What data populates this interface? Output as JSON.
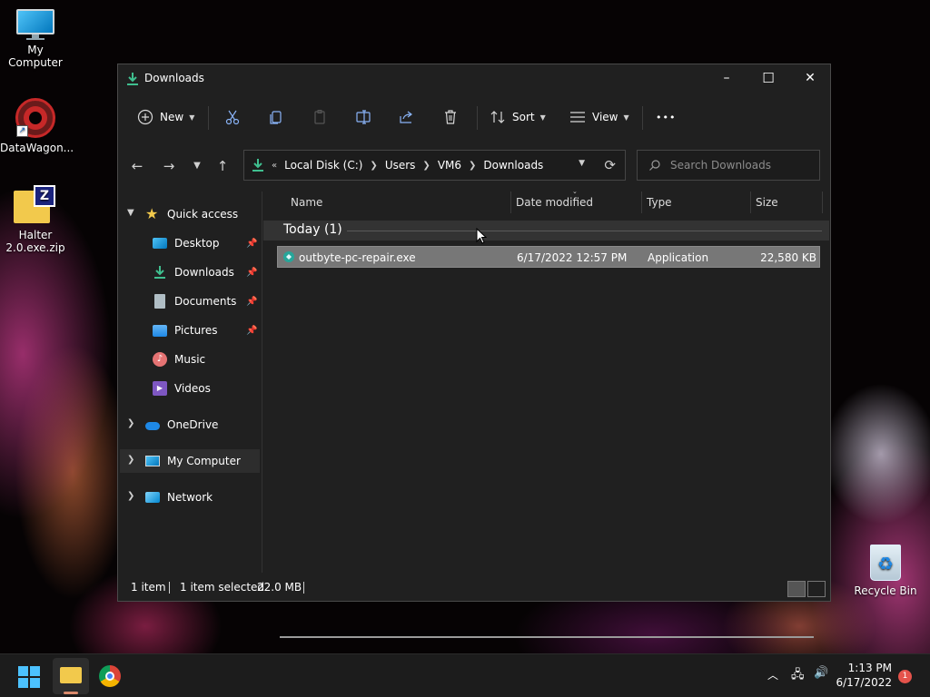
{
  "desktop": {
    "icons": [
      {
        "label": "My Computer"
      },
      {
        "label": "DataWagon..."
      },
      {
        "label": "Halter 2.0.exe.zip"
      },
      {
        "label": "Recycle Bin"
      }
    ]
  },
  "window": {
    "title": "Downloads",
    "controls": {
      "minimize": "–",
      "maximize": "☐",
      "close": "✕"
    }
  },
  "toolbar": {
    "new_label": "New",
    "sort_label": "Sort",
    "view_label": "View",
    "more_label": "•••"
  },
  "address": {
    "overflow": "«",
    "crumbs": [
      "Local Disk (C:)",
      "Users",
      "VM6",
      "Downloads"
    ]
  },
  "search": {
    "placeholder": "Search Downloads"
  },
  "sidebar": {
    "quick_access": "Quick access",
    "items": [
      {
        "label": "Desktop",
        "pinned": true
      },
      {
        "label": "Downloads",
        "pinned": true
      },
      {
        "label": "Documents",
        "pinned": true
      },
      {
        "label": "Pictures",
        "pinned": true
      },
      {
        "label": "Music",
        "pinned": false
      },
      {
        "label": "Videos",
        "pinned": false
      }
    ],
    "onedrive": "OneDrive",
    "my_computer": "My Computer",
    "network": "Network"
  },
  "columns": {
    "name": "Name",
    "date_modified": "Date modified",
    "type": "Type",
    "size": "Size"
  },
  "group": {
    "label": "Today (1)"
  },
  "files": [
    {
      "name": "outbyte-pc-repair.exe",
      "date_modified": "6/17/2022 12:57 PM",
      "type": "Application",
      "size": "22,580 KB"
    }
  ],
  "status": {
    "items": "1 item",
    "selected": "1 item selected",
    "size": "22.0 MB"
  },
  "taskbar": {
    "time": "1:13 PM",
    "date": "6/17/2022",
    "notifications": "1"
  },
  "colors": {
    "window_bg": "#202020",
    "selection": "#777777",
    "taskbar_bg": "#1c1c1c",
    "accent_green": "#3fbf8f",
    "notification": "#e5534b"
  }
}
